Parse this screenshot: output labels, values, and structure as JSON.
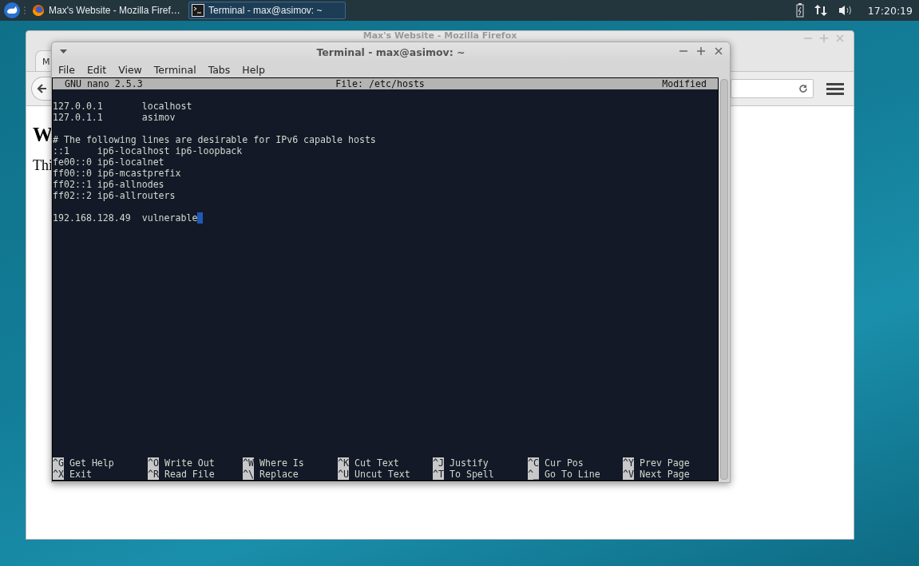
{
  "taskbar": {
    "tasks": [
      {
        "label": "Max's Website - Mozilla Firef…",
        "kind": "firefox",
        "selected": false
      },
      {
        "label": "Terminal - max@asimov: ~",
        "kind": "terminal",
        "selected": true
      }
    ],
    "clock": "17:20:19"
  },
  "firefox": {
    "title": "Max's Website - Mozilla Firefox",
    "tab_label": "M",
    "heading": "W",
    "paragraph": "Thi"
  },
  "terminal": {
    "title": "Terminal - max@asimov: ~",
    "menu": [
      "File",
      "Edit",
      "View",
      "Terminal",
      "Tabs",
      "Help"
    ],
    "nano": {
      "version": "GNU nano 2.5.3",
      "file": "File: /etc/hosts",
      "status": "Modified",
      "blocks": [
        [
          "127.0.0.1       localhost",
          "127.0.1.1       asimov"
        ],
        [
          "# The following lines are desirable for IPv6 capable hosts",
          "::1     ip6-localhost ip6-loopback",
          "fe00::0 ip6-localnet",
          "ff00::0 ip6-mcastprefix",
          "ff02::1 ip6-allnodes",
          "ff02::2 ip6-allrouters"
        ],
        [
          "192.168.128.49  vulnerable"
        ]
      ],
      "shortcuts": [
        {
          "key": "^G",
          "label": "Get Help"
        },
        {
          "key": "^O",
          "label": "Write Out"
        },
        {
          "key": "^W",
          "label": "Where Is"
        },
        {
          "key": "^K",
          "label": "Cut Text"
        },
        {
          "key": "^J",
          "label": "Justify"
        },
        {
          "key": "^C",
          "label": "Cur Pos"
        },
        {
          "key": "^Y",
          "label": "Prev Page"
        },
        {
          "key": "^X",
          "label": "Exit"
        },
        {
          "key": "^R",
          "label": "Read File"
        },
        {
          "key": "^\\",
          "label": "Replace"
        },
        {
          "key": "^U",
          "label": "Uncut Text"
        },
        {
          "key": "^T",
          "label": "To Spell"
        },
        {
          "key": "^_",
          "label": "Go To Line"
        },
        {
          "key": "^V",
          "label": "Next Page"
        }
      ]
    }
  }
}
